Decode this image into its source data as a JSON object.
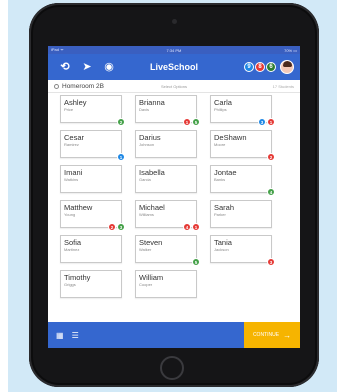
{
  "app": {
    "title": "LiveSchool"
  },
  "status_bar": {
    "left": "iPad ᯤ",
    "time": "7:34 PM",
    "right": "70% ▭"
  },
  "nav": {
    "icons": [
      "refresh-icon",
      "send-icon",
      "eye-icon"
    ],
    "badges": [
      {
        "value": "9",
        "color": "#1e88e5"
      },
      {
        "value": "8",
        "color": "#e53935"
      },
      {
        "value": "6",
        "color": "#2e7d32"
      }
    ]
  },
  "subheader": {
    "class_name": "Homeroom 2B",
    "center": "Select Options",
    "right": "17 Students"
  },
  "students": [
    {
      "first": "Ashley",
      "last": "Price",
      "dots": [
        {
          "value": "2",
          "color": "#43a047"
        }
      ]
    },
    {
      "first": "Brianna",
      "last": "Davis",
      "dots": [
        {
          "value": "1",
          "color": "#e53935"
        },
        {
          "value": "5",
          "color": "#43a047"
        }
      ]
    },
    {
      "first": "Carla",
      "last": "Phillips",
      "dots": [
        {
          "value": "3",
          "color": "#1e88e5"
        },
        {
          "value": "1",
          "color": "#e53935"
        }
      ]
    },
    {
      "first": "Cesar",
      "last": "Ramirez",
      "dots": [
        {
          "value": "1",
          "color": "#1e88e5"
        }
      ]
    },
    {
      "first": "Darius",
      "last": "Johnson",
      "dots": []
    },
    {
      "first": "DeShawn",
      "last": "Moore",
      "dots": [
        {
          "value": "2",
          "color": "#e53935"
        }
      ]
    },
    {
      "first": "Imani",
      "last": "Watkins",
      "dots": []
    },
    {
      "first": "Isabella",
      "last": "Garcia",
      "dots": []
    },
    {
      "first": "Jontae",
      "last": "Banks",
      "dots": [
        {
          "value": "4",
          "color": "#43a047"
        }
      ]
    },
    {
      "first": "Matthew",
      "last": "Young",
      "dots": [
        {
          "value": "2",
          "color": "#e53935"
        },
        {
          "value": "3",
          "color": "#43a047"
        }
      ]
    },
    {
      "first": "Michael",
      "last": "Williams",
      "dots": [
        {
          "value": "4",
          "color": "#e53935"
        },
        {
          "value": "1",
          "color": "#e53935"
        }
      ]
    },
    {
      "first": "Sarah",
      "last": "Parker",
      "dots": []
    },
    {
      "first": "Sofia",
      "last": "Martinez",
      "dots": []
    },
    {
      "first": "Steven",
      "last": "Walker",
      "dots": [
        {
          "value": "5",
          "color": "#43a047"
        }
      ]
    },
    {
      "first": "Tania",
      "last": "Jackson",
      "dots": [
        {
          "value": "3",
          "color": "#e53935"
        }
      ]
    },
    {
      "first": "Timothy",
      "last": "Griggs",
      "dots": []
    },
    {
      "first": "William",
      "last": "Cooper",
      "dots": []
    }
  ],
  "bottom": {
    "continue_label": "CONTINUE"
  }
}
